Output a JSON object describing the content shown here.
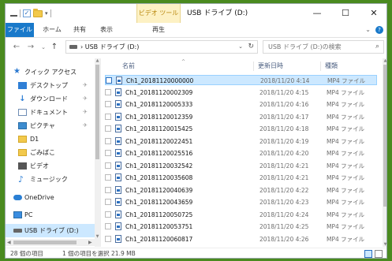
{
  "window": {
    "title": "USB ドライブ (D:)",
    "tool_context_label": "ビデオ ツール",
    "controls": {
      "minimize": "—",
      "maximize": "☐",
      "close": "✕"
    }
  },
  "ribbon": {
    "tabs": [
      "ファイル",
      "ホーム",
      "共有",
      "表示",
      "再生"
    ],
    "collapse_glyph": "⌄",
    "help_glyph": "?"
  },
  "addressbar": {
    "back": "←",
    "forward": "→",
    "recent": "⌄",
    "up": "↑",
    "path": "›  USB ドライブ (D:)",
    "dropdown": "⌄",
    "refresh": "↻",
    "search_placeholder": "USB ドライブ (D:)の検索",
    "search_glyph": "⌕"
  },
  "nav": {
    "items": [
      {
        "label": "クイック アクセス",
        "icon": "star-icon",
        "glyph": "★",
        "pinned": false
      },
      {
        "label": "デスクトップ",
        "icon": "desktop-icon",
        "glyph": "",
        "pinned": true
      },
      {
        "label": "ダウンロード",
        "icon": "download-icon",
        "glyph": "↓",
        "pinned": true
      },
      {
        "label": "ドキュメント",
        "icon": "document-icon",
        "glyph": "",
        "pinned": true
      },
      {
        "label": "ピクチャ",
        "icon": "pictures-icon",
        "glyph": "",
        "pinned": true
      },
      {
        "label": "D1",
        "icon": "folder-icon",
        "glyph": "",
        "pinned": false
      },
      {
        "label": "ごみばこ",
        "icon": "folder-icon",
        "glyph": "",
        "pinned": false
      },
      {
        "label": "ビデオ",
        "icon": "video-icon",
        "glyph": "",
        "pinned": false
      },
      {
        "label": "ミュージック",
        "icon": "music-icon",
        "glyph": "♪",
        "pinned": false
      },
      {
        "label": "OneDrive",
        "icon": "onedrive-icon",
        "glyph": "",
        "pinned": false
      },
      {
        "label": "PC",
        "icon": "pc-icon",
        "glyph": "",
        "pinned": false
      },
      {
        "label": "USB ドライブ (D:)",
        "icon": "usb-drive-icon",
        "glyph": "",
        "pinned": false
      }
    ],
    "pin_glyph": "✈"
  },
  "columns": {
    "name": "名前",
    "date": "更新日時",
    "type": "種類"
  },
  "files": [
    {
      "name": "Ch1_20181120000000",
      "date": "2018/11/20 4:14",
      "type": "MP4 ファイル",
      "selected": true
    },
    {
      "name": "Ch1_20181120002309",
      "date": "2018/11/20 4:15",
      "type": "MP4 ファイル",
      "selected": false
    },
    {
      "name": "Ch1_20181120005333",
      "date": "2018/11/20 4:16",
      "type": "MP4 ファイル",
      "selected": false
    },
    {
      "name": "Ch1_20181120012359",
      "date": "2018/11/20 4:17",
      "type": "MP4 ファイル",
      "selected": false
    },
    {
      "name": "Ch1_20181120015425",
      "date": "2018/11/20 4:18",
      "type": "MP4 ファイル",
      "selected": false
    },
    {
      "name": "Ch1_20181120022451",
      "date": "2018/11/20 4:19",
      "type": "MP4 ファイル",
      "selected": false
    },
    {
      "name": "Ch1_20181120025516",
      "date": "2018/11/20 4:20",
      "type": "MP4 ファイル",
      "selected": false
    },
    {
      "name": "Ch1_20181120032542",
      "date": "2018/11/20 4:21",
      "type": "MP4 ファイル",
      "selected": false
    },
    {
      "name": "Ch1_20181120035608",
      "date": "2018/11/20 4:21",
      "type": "MP4 ファイル",
      "selected": false
    },
    {
      "name": "Ch1_20181120040639",
      "date": "2018/11/20 4:22",
      "type": "MP4 ファイル",
      "selected": false
    },
    {
      "name": "Ch1_20181120043659",
      "date": "2018/11/20 4:23",
      "type": "MP4 ファイル",
      "selected": false
    },
    {
      "name": "Ch1_20181120050725",
      "date": "2018/11/20 4:24",
      "type": "MP4 ファイル",
      "selected": false
    },
    {
      "name": "Ch1_20181120053751",
      "date": "2018/11/20 4:25",
      "type": "MP4 ファイル",
      "selected": false
    },
    {
      "name": "Ch1_20181120060817",
      "date": "2018/11/20 4:26",
      "type": "MP4 ファイル",
      "selected": false
    }
  ],
  "status": {
    "count": "28 個の項目",
    "selection": "1 個の項目を選択 21.9 MB"
  },
  "colors": {
    "accent": "#1979ca",
    "selection": "#cce8ff",
    "tool_context": "#fdf1c4",
    "folder": "#f2c94c",
    "outer_bg": "#4a8a1f"
  }
}
